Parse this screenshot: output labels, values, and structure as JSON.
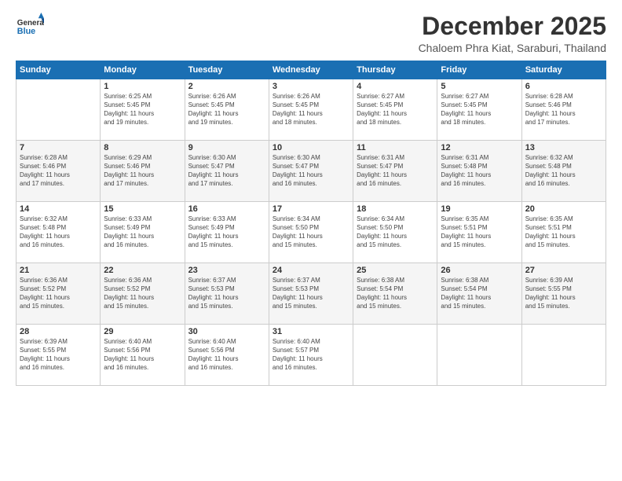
{
  "header": {
    "logo": {
      "general": "General",
      "blue": "Blue"
    },
    "title": "December 2025",
    "location": "Chaloem Phra Kiat, Saraburi, Thailand"
  },
  "weekdays": [
    "Sunday",
    "Monday",
    "Tuesday",
    "Wednesday",
    "Thursday",
    "Friday",
    "Saturday"
  ],
  "weeks": [
    [
      {
        "day": "",
        "info": ""
      },
      {
        "day": "1",
        "info": "Sunrise: 6:25 AM\nSunset: 5:45 PM\nDaylight: 11 hours\nand 19 minutes."
      },
      {
        "day": "2",
        "info": "Sunrise: 6:26 AM\nSunset: 5:45 PM\nDaylight: 11 hours\nand 19 minutes."
      },
      {
        "day": "3",
        "info": "Sunrise: 6:26 AM\nSunset: 5:45 PM\nDaylight: 11 hours\nand 18 minutes."
      },
      {
        "day": "4",
        "info": "Sunrise: 6:27 AM\nSunset: 5:45 PM\nDaylight: 11 hours\nand 18 minutes."
      },
      {
        "day": "5",
        "info": "Sunrise: 6:27 AM\nSunset: 5:45 PM\nDaylight: 11 hours\nand 18 minutes."
      },
      {
        "day": "6",
        "info": "Sunrise: 6:28 AM\nSunset: 5:46 PM\nDaylight: 11 hours\nand 17 minutes."
      }
    ],
    [
      {
        "day": "7",
        "info": "Sunrise: 6:28 AM\nSunset: 5:46 PM\nDaylight: 11 hours\nand 17 minutes."
      },
      {
        "day": "8",
        "info": "Sunrise: 6:29 AM\nSunset: 5:46 PM\nDaylight: 11 hours\nand 17 minutes."
      },
      {
        "day": "9",
        "info": "Sunrise: 6:30 AM\nSunset: 5:47 PM\nDaylight: 11 hours\nand 17 minutes."
      },
      {
        "day": "10",
        "info": "Sunrise: 6:30 AM\nSunset: 5:47 PM\nDaylight: 11 hours\nand 16 minutes."
      },
      {
        "day": "11",
        "info": "Sunrise: 6:31 AM\nSunset: 5:47 PM\nDaylight: 11 hours\nand 16 minutes."
      },
      {
        "day": "12",
        "info": "Sunrise: 6:31 AM\nSunset: 5:48 PM\nDaylight: 11 hours\nand 16 minutes."
      },
      {
        "day": "13",
        "info": "Sunrise: 6:32 AM\nSunset: 5:48 PM\nDaylight: 11 hours\nand 16 minutes."
      }
    ],
    [
      {
        "day": "14",
        "info": "Sunrise: 6:32 AM\nSunset: 5:48 PM\nDaylight: 11 hours\nand 16 minutes."
      },
      {
        "day": "15",
        "info": "Sunrise: 6:33 AM\nSunset: 5:49 PM\nDaylight: 11 hours\nand 16 minutes."
      },
      {
        "day": "16",
        "info": "Sunrise: 6:33 AM\nSunset: 5:49 PM\nDaylight: 11 hours\nand 15 minutes."
      },
      {
        "day": "17",
        "info": "Sunrise: 6:34 AM\nSunset: 5:50 PM\nDaylight: 11 hours\nand 15 minutes."
      },
      {
        "day": "18",
        "info": "Sunrise: 6:34 AM\nSunset: 5:50 PM\nDaylight: 11 hours\nand 15 minutes."
      },
      {
        "day": "19",
        "info": "Sunrise: 6:35 AM\nSunset: 5:51 PM\nDaylight: 11 hours\nand 15 minutes."
      },
      {
        "day": "20",
        "info": "Sunrise: 6:35 AM\nSunset: 5:51 PM\nDaylight: 11 hours\nand 15 minutes."
      }
    ],
    [
      {
        "day": "21",
        "info": "Sunrise: 6:36 AM\nSunset: 5:52 PM\nDaylight: 11 hours\nand 15 minutes."
      },
      {
        "day": "22",
        "info": "Sunrise: 6:36 AM\nSunset: 5:52 PM\nDaylight: 11 hours\nand 15 minutes."
      },
      {
        "day": "23",
        "info": "Sunrise: 6:37 AM\nSunset: 5:53 PM\nDaylight: 11 hours\nand 15 minutes."
      },
      {
        "day": "24",
        "info": "Sunrise: 6:37 AM\nSunset: 5:53 PM\nDaylight: 11 hours\nand 15 minutes."
      },
      {
        "day": "25",
        "info": "Sunrise: 6:38 AM\nSunset: 5:54 PM\nDaylight: 11 hours\nand 15 minutes."
      },
      {
        "day": "26",
        "info": "Sunrise: 6:38 AM\nSunset: 5:54 PM\nDaylight: 11 hours\nand 15 minutes."
      },
      {
        "day": "27",
        "info": "Sunrise: 6:39 AM\nSunset: 5:55 PM\nDaylight: 11 hours\nand 15 minutes."
      }
    ],
    [
      {
        "day": "28",
        "info": "Sunrise: 6:39 AM\nSunset: 5:55 PM\nDaylight: 11 hours\nand 16 minutes."
      },
      {
        "day": "29",
        "info": "Sunrise: 6:40 AM\nSunset: 5:56 PM\nDaylight: 11 hours\nand 16 minutes."
      },
      {
        "day": "30",
        "info": "Sunrise: 6:40 AM\nSunset: 5:56 PM\nDaylight: 11 hours\nand 16 minutes."
      },
      {
        "day": "31",
        "info": "Sunrise: 6:40 AM\nSunset: 5:57 PM\nDaylight: 11 hours\nand 16 minutes."
      },
      {
        "day": "",
        "info": ""
      },
      {
        "day": "",
        "info": ""
      },
      {
        "day": "",
        "info": ""
      }
    ]
  ]
}
